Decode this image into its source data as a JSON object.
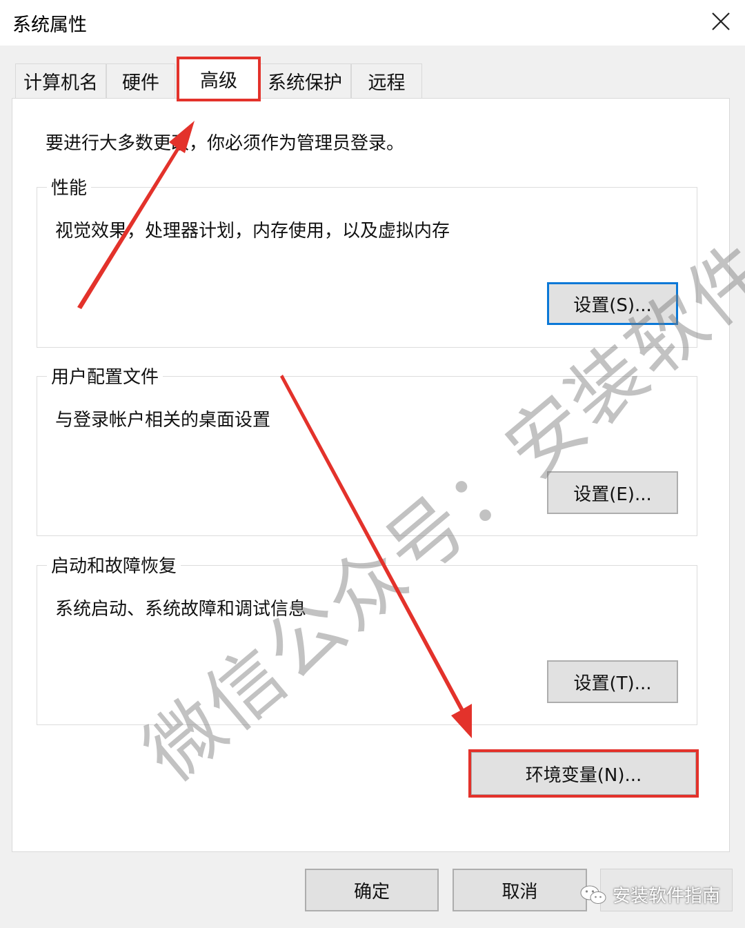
{
  "window": {
    "title": "系统属性"
  },
  "tabs": [
    {
      "label": "计算机名"
    },
    {
      "label": "硬件"
    },
    {
      "label": "高级"
    },
    {
      "label": "系统保护"
    },
    {
      "label": "远程"
    }
  ],
  "active_tab": "高级",
  "admin_note": "要进行大多数更改，你必须作为管理员登录。",
  "groups": {
    "performance": {
      "title": "性能",
      "desc": "视觉效果，处理器计划，内存使用，以及虚拟内存",
      "button": "设置(S)..."
    },
    "user_profiles": {
      "title": "用户配置文件",
      "desc": "与登录帐户相关的桌面设置",
      "button": "设置(E)..."
    },
    "startup_recovery": {
      "title": "启动和故障恢复",
      "desc": "系统启动、系统故障和调试信息",
      "button": "设置(T)..."
    }
  },
  "env_button": "环境变量(N)...",
  "footer": {
    "ok": "确定",
    "cancel": "取消"
  },
  "watermark": {
    "diagonal": "微信公众号：安装软件指南",
    "badge": "安装软件指南"
  },
  "annotation_color": "#e3322b",
  "focus_color": "#0a78d7"
}
